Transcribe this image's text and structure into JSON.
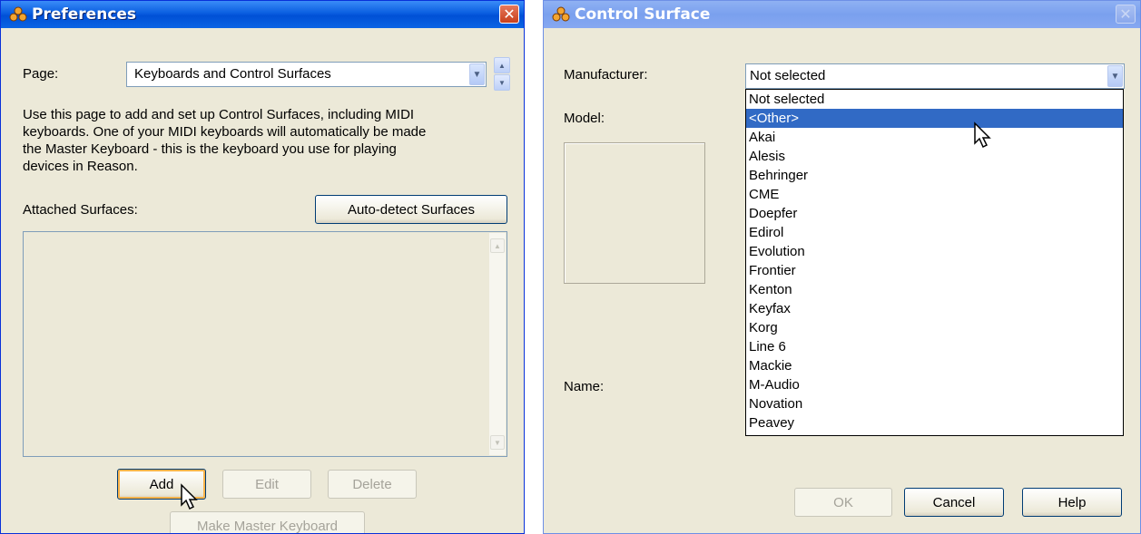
{
  "preferences": {
    "title": "Preferences",
    "page_label": "Page:",
    "page_value": "Keyboards and Control Surfaces",
    "description_lines": [
      "Use this page to add and set up Control Surfaces, including MIDI",
      "keyboards. One of your MIDI keyboards will automatically be made",
      "the Master Keyboard - this is the keyboard you use for playing",
      "devices in Reason."
    ],
    "attached_label": "Attached Surfaces:",
    "autodetect_label": "Auto-detect Surfaces",
    "add_label": "Add",
    "edit_label": "Edit",
    "delete_label": "Delete",
    "master_label": "Make Master Keyboard"
  },
  "control_surface": {
    "title": "Control Surface",
    "manufacturer_label": "Manufacturer:",
    "manufacturer_value": "Not selected",
    "model_label": "Model:",
    "name_label": "Name:",
    "ok_label": "OK",
    "cancel_label": "Cancel",
    "help_label": "Help",
    "manufacturer_options": [
      "Not selected",
      "<Other>",
      "Akai",
      "Alesis",
      "Behringer",
      "CME",
      "Doepfer",
      "Edirol",
      "Evolution",
      "Frontier",
      "Kenton",
      "Keyfax",
      "Korg",
      "Line 6",
      "Mackie",
      "M-Audio",
      "Novation",
      "Peavey"
    ],
    "highlighted_option": "<Other>"
  },
  "icons": {
    "app": "reason-app-icon",
    "close": "close-icon",
    "dropdown": "chevron-down-icon",
    "pointer": "mouse-pointer-icon"
  },
  "colors": {
    "titlebar_active": "#0a5ee0",
    "titlebar_inactive": "#7aa0ee",
    "selection": "#316ac5",
    "dialog_face": "#ece9d8",
    "close_button": "#c8401c"
  }
}
